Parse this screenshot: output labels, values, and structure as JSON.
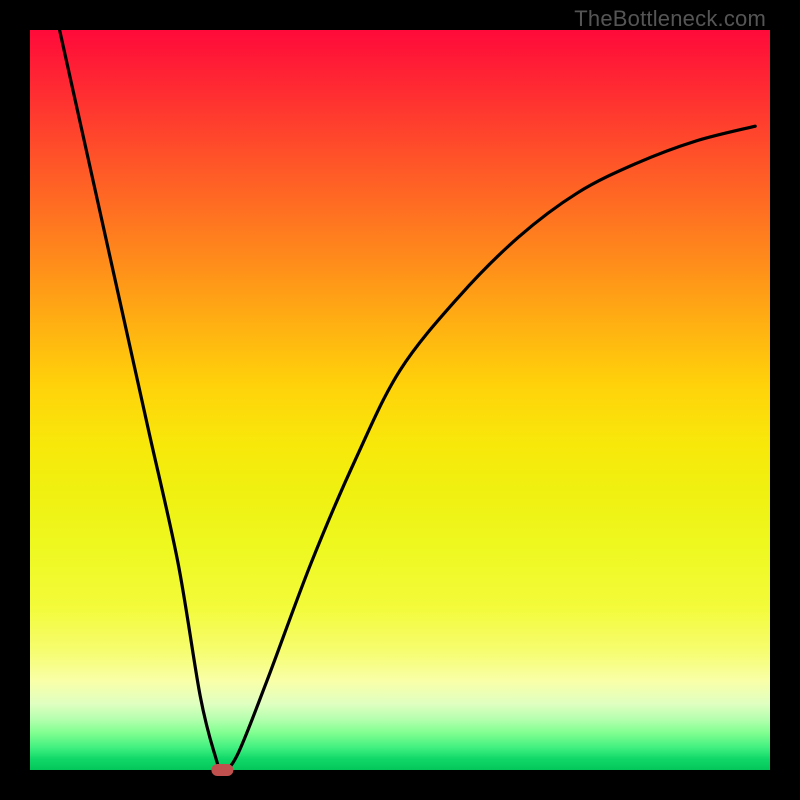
{
  "watermark": "TheBottleneck.com",
  "chart_data": {
    "type": "line",
    "title": "",
    "xlabel": "",
    "ylabel": "",
    "xlim": [
      0,
      100
    ],
    "ylim": [
      0,
      100
    ],
    "background_gradient": {
      "top_color": "#ff0a3a",
      "bottom_color": "#04c65a",
      "note": "red-high to green-low"
    },
    "series": [
      {
        "name": "bottleneck-curve",
        "x": [
          4,
          8,
          12,
          16,
          20,
          23,
          25,
          26,
          28,
          32,
          38,
          44,
          50,
          58,
          66,
          74,
          82,
          90,
          98
        ],
        "values": [
          100,
          82,
          64,
          46,
          28,
          10,
          2,
          0,
          2,
          12,
          28,
          42,
          54,
          64,
          72,
          78,
          82,
          85,
          87
        ]
      }
    ],
    "annotations": [
      {
        "name": "minimum-point",
        "x": 26,
        "y": 0,
        "shape": "capsule",
        "color": "#c0504d"
      }
    ]
  }
}
